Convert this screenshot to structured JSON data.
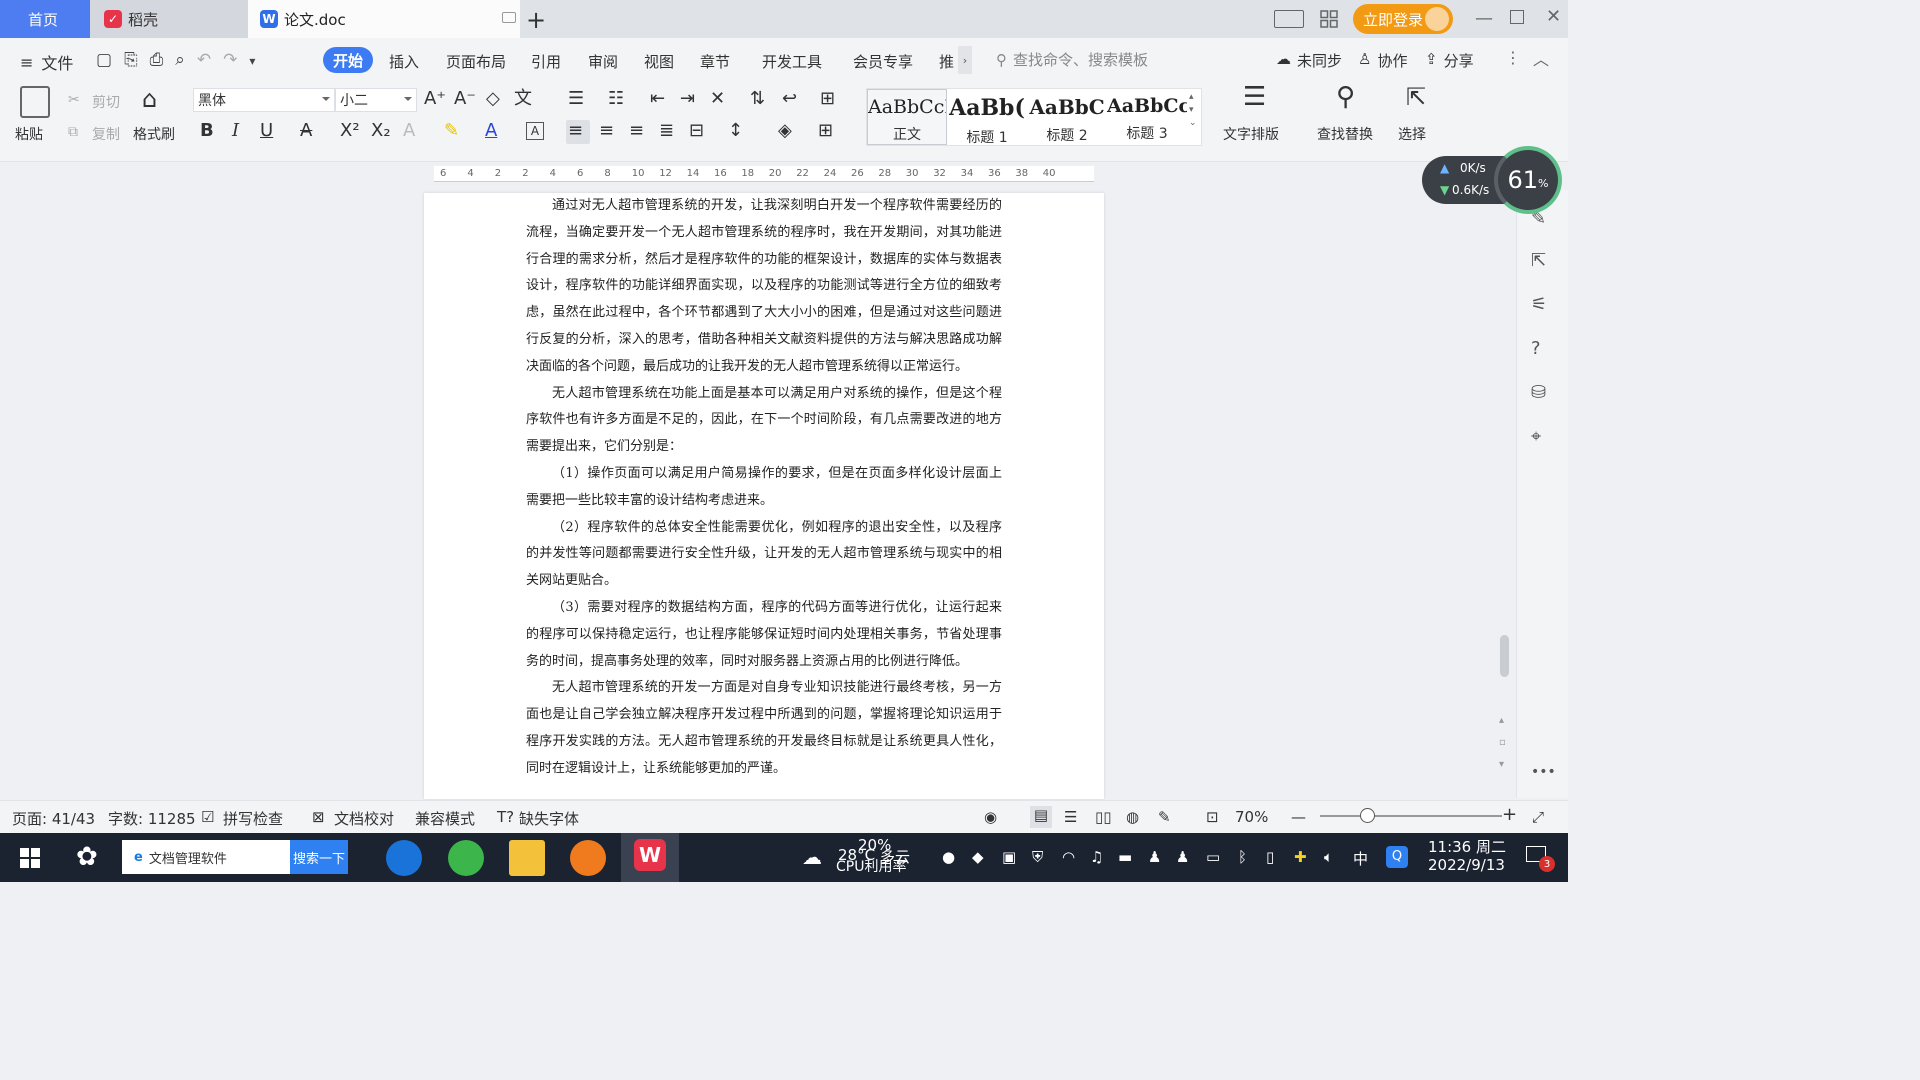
{
  "tabs": {
    "home": "首页",
    "daoke": "稻壳",
    "doc": "论文.doc",
    "login": "立即登录"
  },
  "menu": {
    "file": "文件",
    "items": [
      "开始",
      "插入",
      "页面布局",
      "引用",
      "审阅",
      "视图",
      "章节",
      "开发工具",
      "会员专享",
      "推"
    ],
    "search_placeholder": "查找命令、搜索模板",
    "unsynced": "未同步",
    "collab": "协作",
    "share": "分享"
  },
  "ribbon": {
    "paste": "粘贴",
    "cut": "剪切",
    "copy": "复制",
    "format_painter": "格式刷",
    "font_name": "黑体",
    "font_size": "小二",
    "styles": [
      {
        "preview": "AaBbCcI",
        "name": "正文"
      },
      {
        "preview": "AaBb(",
        "name": "标题 1"
      },
      {
        "preview": "AaBbC",
        "name": "标题 2"
      },
      {
        "preview": "AaBbCcl",
        "name": "标题 3"
      }
    ],
    "text_layout": "文字排版",
    "find_replace": "查找替换",
    "select": "选择"
  },
  "ruler_ticks": [
    "6",
    "4",
    "2",
    "2",
    "4",
    "6",
    "8",
    "10",
    "12",
    "14",
    "16",
    "18",
    "20",
    "22",
    "24",
    "26",
    "28",
    "30",
    "32",
    "34",
    "36",
    "38",
    "40"
  ],
  "document": {
    "paragraphs": [
      "通过对无人超市管理系统的开发，让我深刻明白开发一个程序软件需要经历的流程，当确定要开发一个无人超市管理系统的程序时，我在开发期间，对其功能进行合理的需求分析，然后才是程序软件的功能的框架设计，数据库的实体与数据表设计，程序软件的功能详细界面实现，以及程序的功能测试等进行全方位的细致考虑，虽然在此过程中，各个环节都遇到了大大小小的困难，但是通过对这些问题进行反复的分析，深入的思考，借助各种相关文献资料提供的方法与解决思路成功解决面临的各个问题，最后成功的让我开发的无人超市管理系统得以正常运行。",
      "无人超市管理系统在功能上面是基本可以满足用户对系统的操作，但是这个程序软件也有许多方面是不足的，因此，在下一个时间阶段，有几点需要改进的地方需要提出来，它们分别是：",
      "（1）操作页面可以满足用户简易操作的要求，但是在页面多样化设计层面上需要把一些比较丰富的设计结构考虑进来。",
      "（2）程序软件的总体安全性能需要优化，例如程序的退出安全性，以及程序的并发性等问题都需要进行安全性升级，让开发的无人超市管理系统与现实中的相关网站更贴合。",
      "（3）需要对程序的数据结构方面，程序的代码方面等进行优化，让运行起来的程序可以保持稳定运行，也让程序能够保证短时间内处理相关事务，节省处理事务的时间，提高事务处理的效率，同时对服务器上资源占用的比例进行降低。",
      "无人超市管理系统的开发一方面是对自身专业知识技能进行最终考核，另一方面也是让自己学会独立解决程序开发过程中所遇到的问题，掌握将理论知识运用于程序开发实践的方法。无人超市管理系统的开发最终目标就是让系统更具人性化，同时在逻辑设计上，让系统能够更加的严谨。"
    ]
  },
  "net_widget": {
    "up": "0K/s",
    "down": "0.6K/s",
    "percent": "61",
    "percent_unit": "%"
  },
  "status": {
    "page": "页面: 41/43",
    "words": "字数: 11285",
    "spell": "拼写检查",
    "proof": "文档校对",
    "compat": "兼容模式",
    "missing_font": "缺失字体",
    "zoom": "70%"
  },
  "zoom_fraction": 0.26,
  "taskbar": {
    "search_text": "文档管理软件",
    "search_btn": "搜索一下",
    "weather_temp": "28°C",
    "weather_desc": "多云",
    "cpu_pct": "20%",
    "cpu_label": "CPU利用率",
    "ime": "中",
    "time": "11:36 周二",
    "date": "2022/9/13",
    "notif_count": "3"
  }
}
